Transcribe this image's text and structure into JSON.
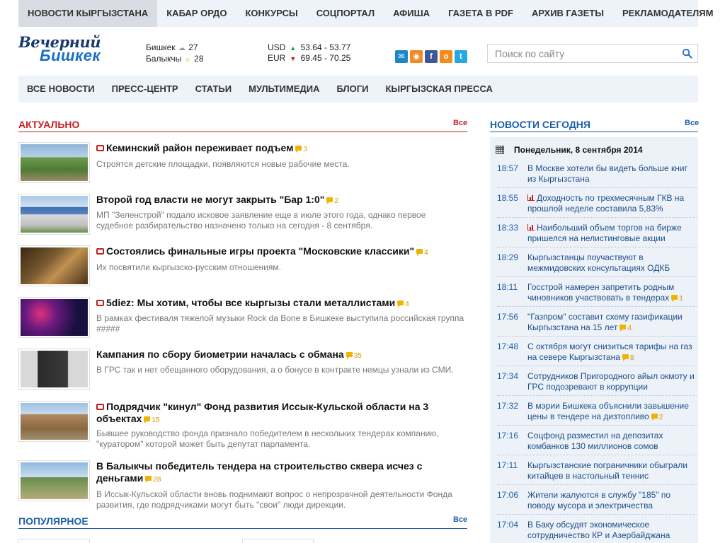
{
  "top_nav": [
    {
      "label": "НОВОСТИ КЫРГЫЗСТАНА",
      "active": true
    },
    {
      "label": "КАБАР ОРДО"
    },
    {
      "label": "КОНКУРСЫ"
    },
    {
      "label": "СОЦПОРТАЛ"
    },
    {
      "label": "АФИША"
    },
    {
      "label": "ГАЗЕТА В PDF"
    },
    {
      "label": "АРХИВ ГАЗЕТЫ"
    },
    {
      "label": "РЕКЛАМОДАТЕЛЯМ"
    }
  ],
  "logo": {
    "line1": "Вечерний",
    "line2": "Бишкек"
  },
  "weather": [
    {
      "city": "Бишкек",
      "temp": "27",
      "icon": "cloud-sun-icon"
    },
    {
      "city": "Балыкчы",
      "temp": "28",
      "icon": "sun-icon"
    }
  ],
  "rates": [
    {
      "cur": "USD",
      "trend": "up",
      "value": "53.64 - 53.77"
    },
    {
      "cur": "EUR",
      "trend": "down",
      "value": "69.45 - 70.25"
    }
  ],
  "social": [
    {
      "name": "mail-icon",
      "glyph": "✉"
    },
    {
      "name": "rss-icon",
      "glyph": "◉"
    },
    {
      "name": "facebook-icon",
      "glyph": "f"
    },
    {
      "name": "odnoklassniki-icon",
      "glyph": "o"
    },
    {
      "name": "twitter-icon",
      "glyph": "t"
    }
  ],
  "search": {
    "placeholder": "Поиск по сайту"
  },
  "sub_nav": [
    {
      "label": "ВСЕ НОВОСТИ"
    },
    {
      "label": "ПРЕСС-ЦЕНТР"
    },
    {
      "label": "СТАТЬИ"
    },
    {
      "label": "МУЛЬТИМЕДИА"
    },
    {
      "label": "БЛОГИ"
    },
    {
      "label": "КЫРГЫЗСКАЯ ПРЕССА"
    }
  ],
  "actual": {
    "title": "АКТУАЛЬНО",
    "all_label": "Все",
    "articles": [
      {
        "title": "Кеминский район переживает подъем",
        "camera": true,
        "comments": "3",
        "desc": "Строятся детские площадки, появляются новые рабочие места."
      },
      {
        "title": "Второй год власти не могут закрыть \"Бар 1:0\"",
        "camera": false,
        "comments": "2",
        "desc": "МП \"Зеленстрой\" подало исковое заявление еще в июле этого года, однако первое судебное разбирательство назначено только на сегодня - 8 сентября."
      },
      {
        "title": "Состоялись финальные игры проекта \"Московские классики\"",
        "camera": true,
        "comments": "4",
        "desc": "Их посвятили кыргызско-русским отношениям."
      },
      {
        "title": "5diez: Мы хотим, чтобы все кыргызы стали металлистами",
        "camera": true,
        "comments": "4",
        "desc": "В рамках фестиваля тяжелой музыки Rock da Bone в Бишкеке выступила российская группа #####"
      },
      {
        "title": "Кампания по сбору биометрии началась с обмана",
        "camera": false,
        "comments": "35",
        "desc": "В ГРС так и нет обещанного оборудования, а о бонусе в контракте немцы узнали из СМИ."
      },
      {
        "title": "Подрядчик \"кинул\" Фонд развития Иссык-Кульской области на 3 объектах",
        "camera": true,
        "comments": "15",
        "desc": "Бывшее руководство фонда признало победителем в нескольких тендерах компанию, \"куратором\" которой может быть депутат парламента."
      },
      {
        "title": "В Балыкчы победитель тендера на строительство сквера исчез с деньгами",
        "camera": false,
        "comments": "28",
        "desc": "В Иссык-Кульской области вновь поднимают вопрос о непрозрачной деятельности Фонда развития, где подрядчиками могут быть \"свои\" люди дирекции."
      }
    ]
  },
  "popular": {
    "title": "ПОПУЛЯРНОЕ",
    "all_label": "Все"
  },
  "today": {
    "title": "НОВОСТИ СЕГОДНЯ",
    "all_label": "Все",
    "date": "Понедельник, 8 сентября 2014",
    "items": [
      {
        "time": "18:57",
        "text": "В Москве хотели бы видеть больше книг из Кыргызстана",
        "chart": false,
        "comments": ""
      },
      {
        "time": "18:55",
        "text": "Доходность по трехмесячным ГКВ на прошлой неделе составила 5,83%",
        "chart": true,
        "comments": ""
      },
      {
        "time": "18:33",
        "text": "Наибольший объем торгов на бирже пришелся на нелистинговые акции",
        "chart": true,
        "comments": ""
      },
      {
        "time": "18:29",
        "text": "Кыргызстанцы поучаствуют в межмидовских консультациях ОДКБ",
        "chart": false,
        "comments": ""
      },
      {
        "time": "18:11",
        "text": "Госстрой намерен запретить родным чиновников участвовать в тендерах",
        "chart": false,
        "comments": "1"
      },
      {
        "time": "17:56",
        "text": "\"Газпром\" составит схему газификации Кыргызстана на 15 лет",
        "chart": false,
        "comments": "4"
      },
      {
        "time": "17:48",
        "text": "С октября могут снизиться тарифы на газ на севере Кыргызстана",
        "chart": false,
        "comments": "8"
      },
      {
        "time": "17:34",
        "text": "Сотрудников Пригородного айыл окмоту и ГРС подозревают в коррупции",
        "chart": false,
        "comments": ""
      },
      {
        "time": "17:32",
        "text": "В мэрии Бишкека объяснили завышение цены в тендере на дизтопливо",
        "chart": false,
        "comments": "2"
      },
      {
        "time": "17:16",
        "text": "Соцфонд разместил на депозитах комбанков 130 миллионов сомов",
        "chart": false,
        "comments": ""
      },
      {
        "time": "17:11",
        "text": "Кыргызстанские пограничники обыграли китайцев в настольный теннис",
        "chart": false,
        "comments": ""
      },
      {
        "time": "17:06",
        "text": "Жители жалуются в службу \"185\" по поводу мусора и электричества",
        "chart": false,
        "comments": ""
      },
      {
        "time": "17:04",
        "text": "В Баку обсудят экономическое сотрудничество КР и Азербайджана",
        "chart": false,
        "comments": ""
      }
    ]
  }
}
